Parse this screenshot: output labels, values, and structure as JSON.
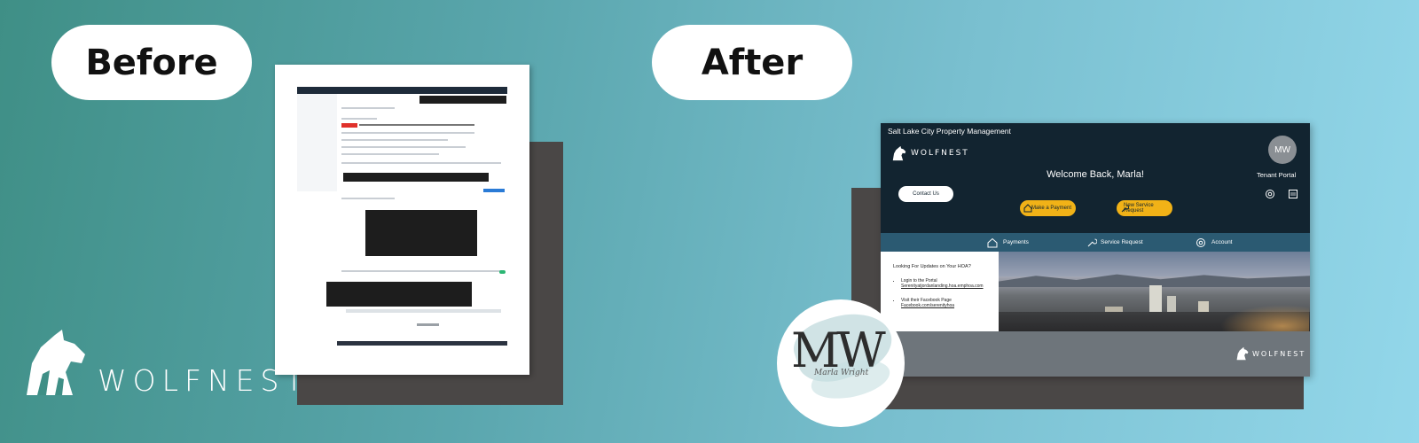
{
  "labels": {
    "before": "Before",
    "after": "After"
  },
  "brand": {
    "wordmark": "WOLFNEST"
  },
  "portal": {
    "company": "Salt Lake City Property Management",
    "logo_text": "WOLFNEST",
    "welcome": "Welcome Back, Marla!",
    "avatar_initials": "MW",
    "tenant_label": "Tenant Portal",
    "contact_button": "Contact Us",
    "make_payment_button": "Make a Payment",
    "service_request_button": "New Service Request",
    "nav": {
      "payments": "Payments",
      "service_request": "Service Request",
      "account": "Account"
    },
    "hoa_question": "Looking For Updates on Your HOA?",
    "bullet1_title": "Login to the Portal",
    "bullet1_link": "Serenityatjordanlanding.hoa.emphoa.com",
    "bullet2_title": "Visit their Facebook Page",
    "bullet2_link": "Facebook.com/serenityhoa",
    "footer_logo_text": "WOLFNEST"
  },
  "badge": {
    "letters": "MW",
    "signature": "Marla Wright"
  },
  "colors": {
    "header": "#122430",
    "nav": "#2b5a72",
    "accent": "#f1b217",
    "shadow": "#4a4746"
  }
}
